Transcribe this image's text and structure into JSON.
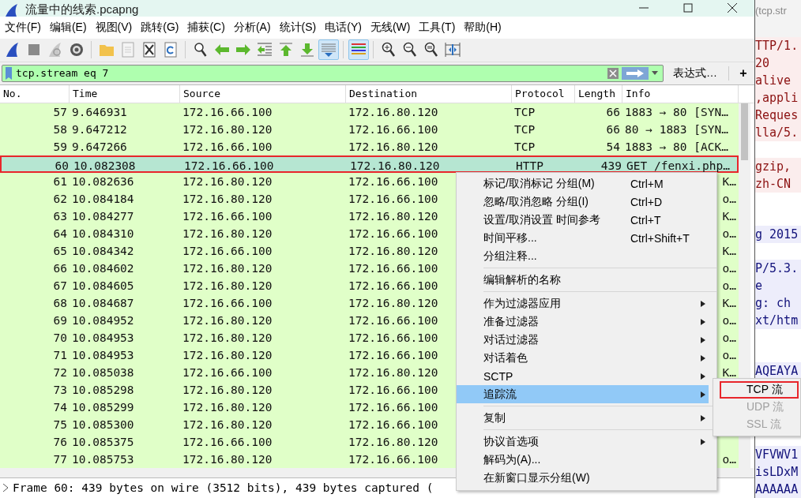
{
  "window": {
    "title": "流量中的线索.pcapng"
  },
  "menu_bar": [
    "文件(F)",
    "编辑(E)",
    "视图(V)",
    "跳转(G)",
    "捕获(C)",
    "分析(A)",
    "统计(S)",
    "电话(Y)",
    "无线(W)",
    "工具(T)",
    "帮助(H)"
  ],
  "toolbar": [
    [
      {
        "pressed": false
      },
      {
        "pressed": false
      },
      {
        "pressed": false
      },
      {
        "pressed": false
      }
    ],
    [
      {
        "pressed": false
      },
      {
        "pressed": false
      },
      {
        "pressed": false
      },
      {
        "pressed": false
      }
    ],
    [
      {
        "pressed": false
      },
      {
        "pressed": false
      },
      {
        "pressed": false
      },
      {
        "pressed": false
      },
      {
        "pressed": false
      },
      {
        "pressed": false
      },
      {
        "pressed": true
      }
    ],
    [
      {
        "pressed": true
      }
    ],
    [
      {
        "pressed": false
      },
      {
        "pressed": false
      },
      {
        "pressed": false
      },
      {
        "pressed": false
      }
    ]
  ],
  "filter": {
    "value": "tcp.stream eq 7",
    "expression_button": "表达式…",
    "add_button": "+"
  },
  "table": {
    "columns": [
      "No.",
      "Time",
      "Source",
      "Destination",
      "Protocol",
      "Length",
      "Info"
    ],
    "rows": [
      {
        "no": "57",
        "time": "9.646931",
        "source": "172.16.66.100",
        "destination": "172.16.80.120",
        "protocol": "TCP",
        "length": "66",
        "info": "1883 → 80 [SYN…",
        "selected": false
      },
      {
        "no": "58",
        "time": "9.647212",
        "source": "172.16.80.120",
        "destination": "172.16.66.100",
        "protocol": "TCP",
        "length": "66",
        "info": "80 → 1883 [SYN…",
        "selected": false
      },
      {
        "no": "59",
        "time": "9.647266",
        "source": "172.16.66.100",
        "destination": "172.16.80.120",
        "protocol": "TCP",
        "length": "54",
        "info": "1883 → 80 [ACK…",
        "selected": false
      },
      {
        "no": "60",
        "time": "10.082308",
        "source": "172.16.66.100",
        "destination": "172.16.80.120",
        "protocol": "HTTP",
        "length": "439",
        "info": "GET /fenxi.php…",
        "selected": true
      },
      {
        "no": "61",
        "time": "10.082636",
        "source": "172.16.80.120",
        "destination": "172.16.66.100",
        "info": "K…",
        "selected": false
      },
      {
        "no": "62",
        "time": "10.084184",
        "source": "172.16.80.120",
        "destination": "172.16.66.100",
        "info": "o…",
        "selected": false
      },
      {
        "no": "63",
        "time": "10.084277",
        "source": "172.16.66.100",
        "destination": "172.16.80.120",
        "info": "K…",
        "selected": false
      },
      {
        "no": "64",
        "time": "10.084310",
        "source": "172.16.80.120",
        "destination": "172.16.66.100",
        "info": "o…",
        "selected": false
      },
      {
        "no": "65",
        "time": "10.084342",
        "source": "172.16.66.100",
        "destination": "172.16.80.120",
        "info": "K…",
        "selected": false
      },
      {
        "no": "66",
        "time": "10.084602",
        "source": "172.16.80.120",
        "destination": "172.16.66.100",
        "info": "o…",
        "selected": false
      },
      {
        "no": "67",
        "time": "10.084605",
        "source": "172.16.80.120",
        "destination": "172.16.66.100",
        "info": "o…",
        "selected": false
      },
      {
        "no": "68",
        "time": "10.084687",
        "source": "172.16.66.100",
        "destination": "172.16.80.120",
        "info": "K…",
        "selected": false
      },
      {
        "no": "69",
        "time": "10.084952",
        "source": "172.16.80.120",
        "destination": "172.16.66.100",
        "info": "o…",
        "selected": false
      },
      {
        "no": "70",
        "time": "10.084953",
        "source": "172.16.80.120",
        "destination": "172.16.66.100",
        "info": "o…",
        "selected": false
      },
      {
        "no": "71",
        "time": "10.084953",
        "source": "172.16.80.120",
        "destination": "172.16.66.100",
        "info": "o…",
        "selected": false
      },
      {
        "no": "72",
        "time": "10.085038",
        "source": "172.16.66.100",
        "destination": "172.16.80.120",
        "info": "K…",
        "selected": false
      },
      {
        "no": "73",
        "time": "10.085298",
        "source": "172.16.80.120",
        "destination": "172.16.66.100",
        "selected": false
      },
      {
        "no": "74",
        "time": "10.085299",
        "source": "172.16.80.120",
        "destination": "172.16.66.100",
        "selected": false
      },
      {
        "no": "75",
        "time": "10.085300",
        "source": "172.16.80.120",
        "destination": "172.16.66.100",
        "selected": false
      },
      {
        "no": "76",
        "time": "10.085375",
        "source": "172.16.66.100",
        "destination": "172.16.80.120",
        "selected": false
      },
      {
        "no": "77",
        "time": "10.085753",
        "source": "172.16.80.120",
        "destination": "172.16.66.100",
        "info": "o…",
        "selected": false
      }
    ]
  },
  "details": {
    "line": "Frame 60: 439 bytes on wire (3512 bits), 439 bytes captured ("
  },
  "context_menu": {
    "groups": [
      [
        {
          "label": "标记/取消标记 分组(M)",
          "shortcut": "Ctrl+M",
          "submenu": false,
          "selected": false
        },
        {
          "label": "忽略/取消忽略 分组(I)",
          "shortcut": "Ctrl+D",
          "submenu": false,
          "selected": false
        },
        {
          "label": "设置/取消设置 时间参考",
          "shortcut": "Ctrl+T",
          "submenu": false,
          "selected": false
        },
        {
          "label": "时间平移...",
          "shortcut": "Ctrl+Shift+T",
          "submenu": false,
          "selected": false
        },
        {
          "label": "分组注释...",
          "submenu": false,
          "selected": false
        }
      ],
      [
        {
          "label": "编辑解析的名称",
          "submenu": false,
          "selected": false
        }
      ],
      [
        {
          "label": "作为过滤器应用",
          "submenu": true,
          "selected": false
        },
        {
          "label": "准备过滤器",
          "submenu": true,
          "selected": false
        },
        {
          "label": "对话过滤器",
          "submenu": true,
          "selected": false
        },
        {
          "label": "对话着色",
          "submenu": true,
          "selected": false
        },
        {
          "label": "SCTP",
          "submenu": true,
          "selected": false
        },
        {
          "label": "追踪流",
          "submenu": true,
          "selected": true
        }
      ],
      [
        {
          "label": "复制",
          "submenu": true,
          "selected": false
        }
      ],
      [
        {
          "label": "协议首选项",
          "submenu": true,
          "selected": false
        },
        {
          "label": "解码为(A)...",
          "submenu": false,
          "selected": false
        },
        {
          "label": "在新窗口显示分组(W)",
          "submenu": false,
          "selected": false
        }
      ]
    ]
  },
  "submenu": [
    {
      "label": "TCP 流",
      "disabled": false,
      "selected": true
    },
    {
      "label": "UDP 流",
      "disabled": true,
      "selected": false
    },
    {
      "label": "SSL 流",
      "disabled": true,
      "selected": false
    }
  ],
  "background_window": {
    "title": "(tcp.str",
    "lines": [
      {
        "kind": "client",
        "text": "TTP/1."
      },
      {
        "kind": "client",
        "text": "20"
      },
      {
        "kind": "client",
        "text": "alive"
      },
      {
        "kind": "client",
        "text": ",appli"
      },
      {
        "kind": "client",
        "text": "Reques"
      },
      {
        "kind": "client",
        "text": "lla/5."
      },
      {
        "kind": "blank"
      },
      {
        "kind": "client",
        "text": "gzip,"
      },
      {
        "kind": "client",
        "text": "zh-CN"
      },
      {
        "kind": "blank"
      },
      {
        "kind": "blank"
      },
      {
        "kind": "server",
        "text": "g 2015"
      },
      {
        "kind": "blank"
      },
      {
        "kind": "server",
        "text": "P/5.3."
      },
      {
        "kind": "server",
        "text": "e"
      },
      {
        "kind": "server",
        "text": "g: ch"
      },
      {
        "kind": "server",
        "text": "xt/htm"
      },
      {
        "kind": "blank"
      },
      {
        "kind": "blank"
      },
      {
        "kind": "server",
        "text": "AQEAYA"
      },
      {
        "kind": "blank"
      },
      {
        "kind": "blank"
      },
      {
        "kind": "blank"
      },
      {
        "kind": "blank"
      },
      {
        "kind": "server",
        "text": "VFVWV1"
      },
      {
        "kind": "server",
        "text": "isLDxM"
      },
      {
        "kind": "server",
        "text": "AAAAAA"
      }
    ]
  }
}
